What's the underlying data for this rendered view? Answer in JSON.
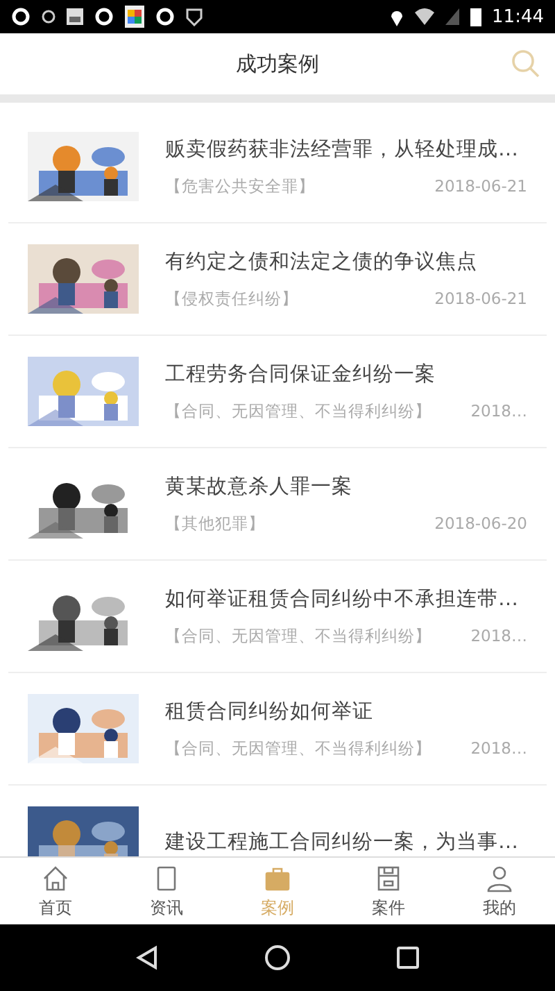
{
  "status_bar": {
    "time": "11:44"
  },
  "header": {
    "title": "成功案例"
  },
  "cases": [
    {
      "title": "贩卖假药获非法经营罪，从轻处理成…",
      "category": "【危害公共安全罪】",
      "date": "2018-06-21"
    },
    {
      "title": "有约定之债和法定之债的争议焦点",
      "category": "【侵权责任纠纷】",
      "date": "2018-06-21"
    },
    {
      "title": "工程劳务合同保证金纠纷一案",
      "category": "【合同、无因管理、不当得利纠纷】",
      "date": "2018…"
    },
    {
      "title": "黄某故意杀人罪一案",
      "category": "【其他犯罪】",
      "date": "2018-06-20"
    },
    {
      "title": "如何举证租赁合同纠纷中不承担连带…",
      "category": "【合同、无因管理、不当得利纠纷】",
      "date": "2018…"
    },
    {
      "title": "租赁合同纠纷如何举证",
      "category": "【合同、无因管理、不当得利纠纷】",
      "date": "2018…"
    },
    {
      "title": "建设工程施工合同纠纷一案，为当事…"
    }
  ],
  "tabs": [
    {
      "kind": "home",
      "label": "首页",
      "selected": false
    },
    {
      "kind": "news",
      "label": "资讯",
      "selected": false
    },
    {
      "kind": "cases",
      "label": "案例",
      "selected": true
    },
    {
      "kind": "files",
      "label": "案件",
      "selected": false
    },
    {
      "kind": "me",
      "label": "我的",
      "selected": false
    }
  ]
}
